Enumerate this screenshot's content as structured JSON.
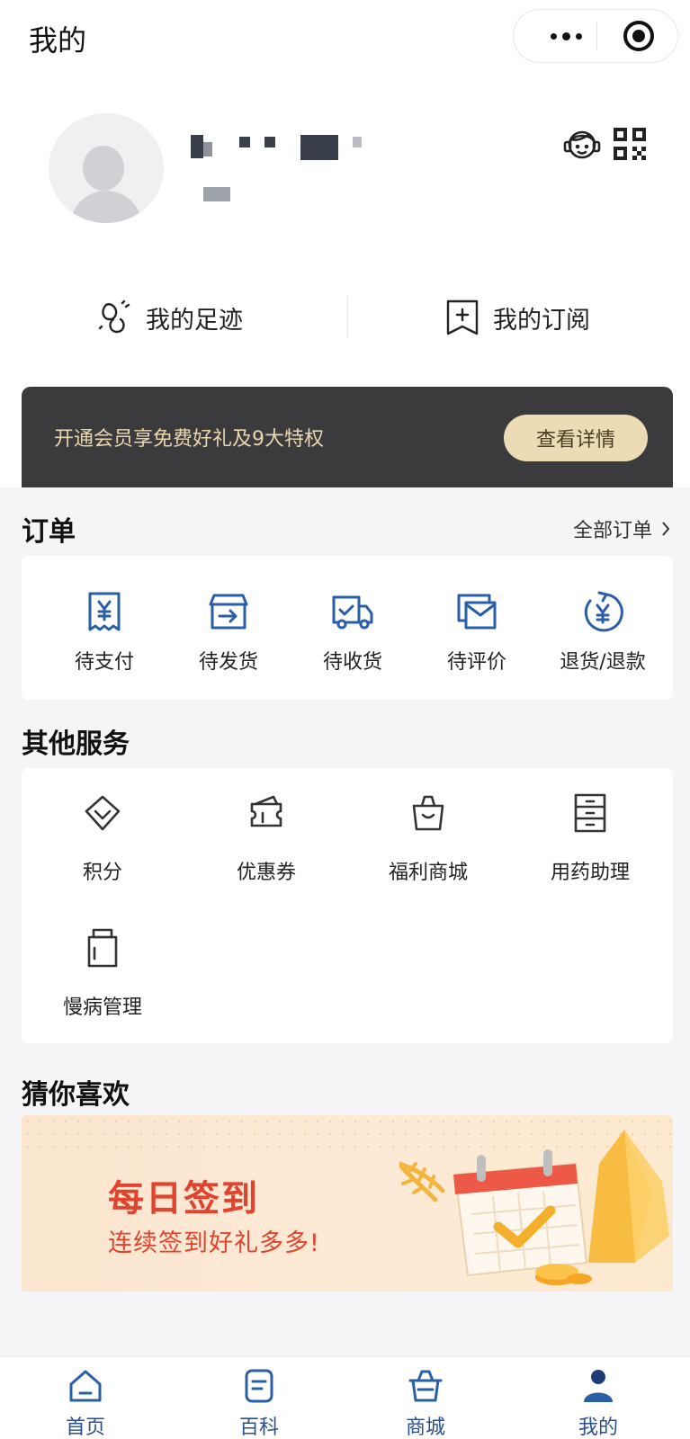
{
  "header": {
    "title": "我的"
  },
  "quick_links": [
    {
      "label": "我的足迹",
      "icon": "footprint-icon"
    },
    {
      "label": "我的订阅",
      "icon": "subscribe-icon"
    }
  ],
  "membership": {
    "text": "开通会员享免费好礼及9大特权",
    "button": "查看详情"
  },
  "orders": {
    "title": "订单",
    "all_link": "全部订单",
    "items": [
      {
        "label": "待支付",
        "icon": "pending-payment-icon"
      },
      {
        "label": "待发货",
        "icon": "pending-shipment-icon"
      },
      {
        "label": "待收货",
        "icon": "pending-receipt-icon"
      },
      {
        "label": "待评价",
        "icon": "pending-review-icon"
      },
      {
        "label": "退货/退款",
        "icon": "refund-icon"
      }
    ]
  },
  "services": {
    "title": "其他服务",
    "items": [
      {
        "label": "积分",
        "icon": "points-icon"
      },
      {
        "label": "优惠券",
        "icon": "coupon-icon"
      },
      {
        "label": "福利商城",
        "icon": "shopping-bag-icon"
      },
      {
        "label": "用药助理",
        "icon": "cabinet-icon"
      },
      {
        "label": "慢病管理",
        "icon": "medicine-bottle-icon"
      }
    ]
  },
  "recommend": {
    "title": "猜你喜欢",
    "banner_title": "每日签到",
    "banner_sub": "连续签到好礼多多!"
  },
  "tabbar": [
    {
      "label": "首页",
      "icon": "home-icon"
    },
    {
      "label": "百科",
      "icon": "encyclopedia-icon"
    },
    {
      "label": "商城",
      "icon": "basket-icon"
    },
    {
      "label": "我的",
      "icon": "profile-icon"
    }
  ],
  "colors": {
    "accent": "#2a5fa8",
    "banner_dark": "#3b3b3e",
    "gold": "#ecdcb6",
    "red": "#e0432e"
  }
}
